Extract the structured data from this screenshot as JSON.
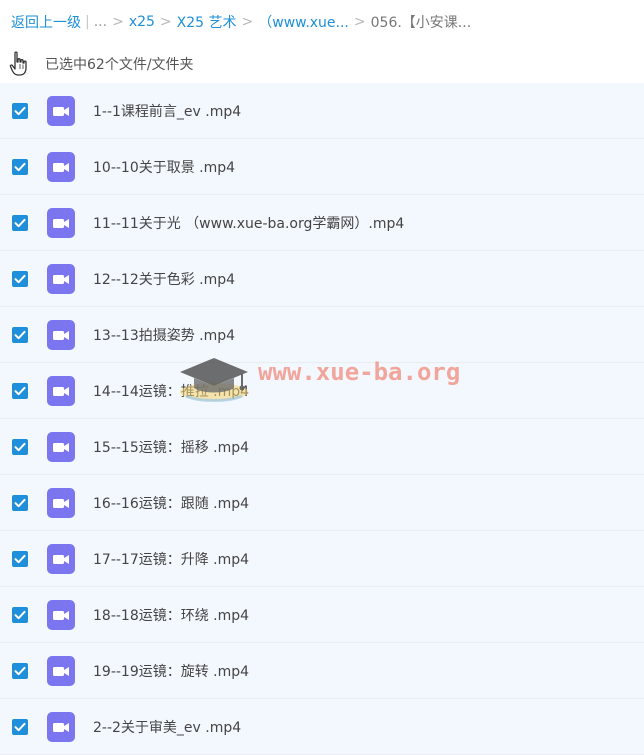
{
  "breadcrumb": {
    "back_label": "返回上一级",
    "ellipsis": "...",
    "items": [
      {
        "label": "x25"
      },
      {
        "label": "X25 艺术"
      },
      {
        "label": "（www.xue..."
      }
    ],
    "current": "056.【小安课..."
  },
  "selection": {
    "text": "已选中62个文件/文件夹"
  },
  "files": [
    {
      "name": "1--1课程前言_ev .mp4",
      "checked": true
    },
    {
      "name": "10--10关于取景 .mp4",
      "checked": true
    },
    {
      "name": "11--11关于光 （www.xue-ba.org学霸网）.mp4",
      "checked": true
    },
    {
      "name": "12--12关于色彩 .mp4",
      "checked": true
    },
    {
      "name": "13--13拍摄姿势 .mp4",
      "checked": true
    },
    {
      "name": "14--14运镜：推拉 .mp4",
      "checked": true
    },
    {
      "name": "15--15运镜：摇移 .mp4",
      "checked": true
    },
    {
      "name": "16--16运镜：跟随 .mp4",
      "checked": true
    },
    {
      "name": "17--17运镜：升降 .mp4",
      "checked": true
    },
    {
      "name": "18--18运镜：环绕 .mp4",
      "checked": true
    },
    {
      "name": "19--19运镜：旋转 .mp4",
      "checked": true
    },
    {
      "name": "2--2关于审美_ev .mp4",
      "checked": true
    }
  ],
  "watermark": {
    "text": "www.xue-ba.org",
    "icon": "graduation-cap-icon"
  },
  "colors": {
    "link": "#1e8fd8",
    "checkbox": "#1e8fd8",
    "video_icon": "#7b76ef",
    "row_bg": "#f3f8ff",
    "watermark": "#f18a7a"
  }
}
